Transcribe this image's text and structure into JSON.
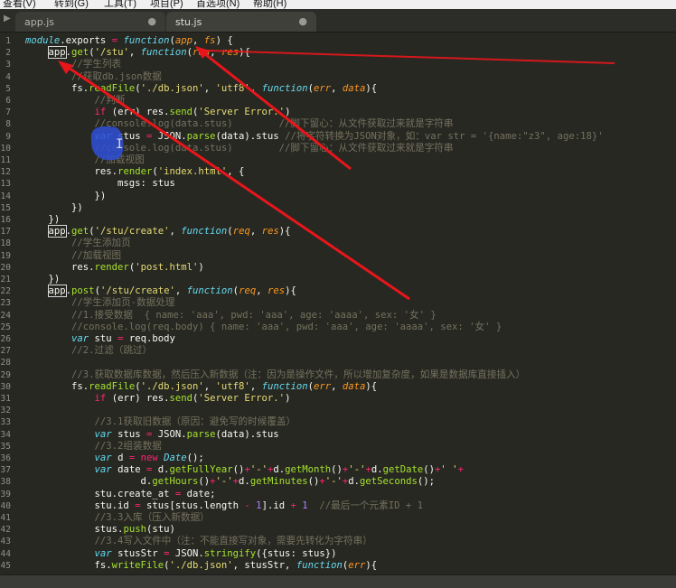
{
  "menu": [
    "查看(V)",
    "转到(G)",
    "工具(T)",
    "项目(P)",
    "首选项(N)",
    "帮助(H)"
  ],
  "tabs": [
    {
      "label": "app.js",
      "active": false,
      "status": "●"
    },
    {
      "label": "stu.js",
      "active": true,
      "status": "●"
    }
  ],
  "icons": {
    "sidebar_toggle": "triangle-right",
    "tab_modified": "dot"
  },
  "colors": {
    "background": "#272822",
    "keyword": "#66d9ef",
    "string": "#e6db74",
    "function_name": "#a6e22e",
    "parameter": "#fd971f",
    "operator": "#f92672",
    "comment": "#75715e",
    "plain": "#f8f8f2",
    "annotation_arrow": "#e8161b",
    "annotation_highlight": "#2f4fd6"
  },
  "code_lines": [
    {
      "n": "1",
      "tokens": [
        [
          "module",
          "i"
        ],
        [
          ".exports ",
          ""
        ],
        [
          "=",
          "o"
        ],
        [
          " ",
          ""
        ],
        [
          "function",
          "k"
        ],
        [
          "(",
          ""
        ],
        [
          "app",
          "p"
        ],
        [
          ", ",
          ""
        ],
        [
          "fs",
          "p"
        ],
        [
          ") {",
          ""
        ]
      ]
    },
    {
      "n": "2",
      "tokens": [
        [
          "    ",
          ""
        ],
        [
          "app",
          "b"
        ],
        [
          ".",
          ""
        ],
        [
          "get",
          "f"
        ],
        [
          "(",
          ""
        ],
        [
          "'/stu'",
          "s"
        ],
        [
          ", ",
          ""
        ],
        [
          "function",
          "k"
        ],
        [
          "(",
          ""
        ],
        [
          "req",
          "p"
        ],
        [
          ", ",
          ""
        ],
        [
          "res",
          "p"
        ],
        [
          "){",
          ""
        ]
      ]
    },
    {
      "n": "3",
      "tokens": [
        [
          "        //学生列表",
          "c"
        ]
      ]
    },
    {
      "n": "4",
      "tokens": [
        [
          "        //获取db.json数据",
          "c"
        ]
      ]
    },
    {
      "n": "5",
      "tokens": [
        [
          "        fs.",
          ""
        ],
        [
          "readFile",
          "f"
        ],
        [
          "(",
          ""
        ],
        [
          "'./db.json'",
          "s"
        ],
        [
          ", ",
          ""
        ],
        [
          "'utf8'",
          "s"
        ],
        [
          ", ",
          ""
        ],
        [
          "function",
          "k"
        ],
        [
          "(",
          ""
        ],
        [
          "err",
          "p"
        ],
        [
          ", ",
          ""
        ],
        [
          "data",
          "p"
        ],
        [
          "){",
          ""
        ]
      ]
    },
    {
      "n": "6",
      "tokens": [
        [
          "            //判断",
          "c"
        ]
      ]
    },
    {
      "n": "7",
      "tokens": [
        [
          "            ",
          ""
        ],
        [
          "if",
          "o"
        ],
        [
          " (err) res.",
          ""
        ],
        [
          "send",
          "f"
        ],
        [
          "(",
          ""
        ],
        [
          "'Server Error.'",
          "s"
        ],
        [
          ")",
          ""
        ]
      ]
    },
    {
      "n": "8",
      "tokens": [
        [
          "            //console.log(data.stus)        //脚下留心：从文件获取过来就是字符串",
          "c"
        ]
      ]
    },
    {
      "n": "9",
      "tokens": [
        [
          "            ",
          ""
        ],
        [
          "var",
          "k"
        ],
        [
          " stus ",
          ""
        ],
        [
          "=",
          "o"
        ],
        [
          " JSON.",
          ""
        ],
        [
          "parse",
          "f"
        ],
        [
          "(data).stus ",
          ""
        ],
        [
          "//将字符转换为JSON对象，如：var str = '{name:\"z3\", age:18}'",
          "c"
        ]
      ]
    },
    {
      "n": "10",
      "tokens": [
        [
          "            //console.log(data.stus)        //脚下留心：从文件获取过来就是字符串",
          "c"
        ]
      ]
    },
    {
      "n": "11",
      "tokens": [
        [
          "            //加载视图",
          "c"
        ]
      ]
    },
    {
      "n": "12",
      "tokens": [
        [
          "            res.",
          ""
        ],
        [
          "render",
          "f"
        ],
        [
          "(",
          ""
        ],
        [
          "'index.html'",
          "s"
        ],
        [
          ", {",
          ""
        ]
      ]
    },
    {
      "n": "13",
      "tokens": [
        [
          "                msgs: stus",
          ""
        ]
      ]
    },
    {
      "n": "14",
      "tokens": [
        [
          "            })",
          ""
        ]
      ]
    },
    {
      "n": "15",
      "tokens": [
        [
          "        })",
          ""
        ]
      ]
    },
    {
      "n": "16",
      "tokens": [
        [
          "    })",
          ""
        ]
      ]
    },
    {
      "n": "17",
      "tokens": [
        [
          "    ",
          ""
        ],
        [
          "app",
          "b"
        ],
        [
          ".",
          ""
        ],
        [
          "get",
          "f"
        ],
        [
          "(",
          ""
        ],
        [
          "'/stu/create'",
          "s"
        ],
        [
          ", ",
          ""
        ],
        [
          "function",
          "k"
        ],
        [
          "(",
          ""
        ],
        [
          "req",
          "p"
        ],
        [
          ", ",
          ""
        ],
        [
          "res",
          "p"
        ],
        [
          "){",
          ""
        ]
      ]
    },
    {
      "n": "18",
      "tokens": [
        [
          "        //学生添加页",
          "c"
        ]
      ]
    },
    {
      "n": "19",
      "tokens": [
        [
          "        //加载视图",
          "c"
        ]
      ]
    },
    {
      "n": "20",
      "tokens": [
        [
          "        res.",
          ""
        ],
        [
          "render",
          "f"
        ],
        [
          "(",
          ""
        ],
        [
          "'post.html'",
          "s"
        ],
        [
          ")",
          ""
        ]
      ]
    },
    {
      "n": "21",
      "tokens": [
        [
          "    })",
          ""
        ]
      ]
    },
    {
      "n": "22",
      "tokens": [
        [
          "    ",
          ""
        ],
        [
          "app",
          "b"
        ],
        [
          ".",
          ""
        ],
        [
          "post",
          "f"
        ],
        [
          "(",
          ""
        ],
        [
          "'/stu/create'",
          "s"
        ],
        [
          ", ",
          ""
        ],
        [
          "function",
          "k"
        ],
        [
          "(",
          ""
        ],
        [
          "req",
          "p"
        ],
        [
          ", ",
          ""
        ],
        [
          "res",
          "p"
        ],
        [
          "){",
          ""
        ]
      ]
    },
    {
      "n": "23",
      "tokens": [
        [
          "        //学生添加页-数据处理",
          "c"
        ]
      ]
    },
    {
      "n": "24",
      "tokens": [
        [
          "        //1.接受数据  { name: 'aaa', pwd: 'aaa', age: 'aaaa', sex: '女' }",
          "c"
        ]
      ]
    },
    {
      "n": "25",
      "tokens": [
        [
          "        //console.log(req.body) { name: 'aaa', pwd: 'aaa', age: 'aaaa', sex: '女' }",
          "c"
        ]
      ]
    },
    {
      "n": "26",
      "tokens": [
        [
          "        ",
          ""
        ],
        [
          "var",
          "k"
        ],
        [
          " stu ",
          ""
        ],
        [
          "=",
          "o"
        ],
        [
          " req.body",
          ""
        ]
      ]
    },
    {
      "n": "27",
      "tokens": [
        [
          "        //2.过滤（跳过）",
          "c"
        ]
      ]
    },
    {
      "n": "28",
      "tokens": [
        [
          "",
          ""
        ]
      ]
    },
    {
      "n": "29",
      "tokens": [
        [
          "        //3.获取数据库数据，然后压入新数据（注：因为是操作文件，所以增加复杂度，如果是数据库直接插入）",
          "c"
        ]
      ]
    },
    {
      "n": "30",
      "tokens": [
        [
          "        fs.",
          ""
        ],
        [
          "readFile",
          "f"
        ],
        [
          "(",
          ""
        ],
        [
          "'./db.json'",
          "s"
        ],
        [
          ", ",
          ""
        ],
        [
          "'utf8'",
          "s"
        ],
        [
          ", ",
          ""
        ],
        [
          "function",
          "k"
        ],
        [
          "(",
          ""
        ],
        [
          "err",
          "p"
        ],
        [
          ", ",
          ""
        ],
        [
          "data",
          "p"
        ],
        [
          "){",
          ""
        ]
      ]
    },
    {
      "n": "31",
      "tokens": [
        [
          "            ",
          ""
        ],
        [
          "if",
          "o"
        ],
        [
          " (err) res.",
          ""
        ],
        [
          "send",
          "f"
        ],
        [
          "(",
          ""
        ],
        [
          "'Server Error.'",
          "s"
        ],
        [
          ")",
          ""
        ]
      ]
    },
    {
      "n": "32",
      "tokens": [
        [
          "",
          ""
        ]
      ]
    },
    {
      "n": "33",
      "tokens": [
        [
          "            //3.1获取旧数据（原因：避免写的时候覆盖）",
          "c"
        ]
      ]
    },
    {
      "n": "34",
      "tokens": [
        [
          "            ",
          ""
        ],
        [
          "var",
          "k"
        ],
        [
          " stus ",
          ""
        ],
        [
          "=",
          "o"
        ],
        [
          " JSON.",
          ""
        ],
        [
          "parse",
          "f"
        ],
        [
          "(data).stus",
          ""
        ]
      ]
    },
    {
      "n": "35",
      "tokens": [
        [
          "            //3.2组装数据",
          "c"
        ]
      ]
    },
    {
      "n": "36",
      "tokens": [
        [
          "            ",
          ""
        ],
        [
          "var",
          "k"
        ],
        [
          " d ",
          ""
        ],
        [
          "=",
          "o"
        ],
        [
          " ",
          ""
        ],
        [
          "new",
          "o"
        ],
        [
          " ",
          ""
        ],
        [
          "Date",
          "i"
        ],
        [
          "();",
          ""
        ]
      ]
    },
    {
      "n": "37",
      "tokens": [
        [
          "            ",
          ""
        ],
        [
          "var",
          "k"
        ],
        [
          " date ",
          ""
        ],
        [
          "=",
          "o"
        ],
        [
          " d.",
          ""
        ],
        [
          "getFullYear",
          "f"
        ],
        [
          "()",
          ""
        ],
        [
          "+",
          "o"
        ],
        [
          "'-'",
          "s"
        ],
        [
          "+",
          "o"
        ],
        [
          "d.",
          ""
        ],
        [
          "getMonth",
          "f"
        ],
        [
          "()",
          ""
        ],
        [
          "+",
          "o"
        ],
        [
          "'-'",
          "s"
        ],
        [
          "+",
          "o"
        ],
        [
          "d.",
          ""
        ],
        [
          "getDate",
          "f"
        ],
        [
          "()",
          ""
        ],
        [
          "+",
          "o"
        ],
        [
          "' '",
          "s"
        ],
        [
          "+",
          "o"
        ]
      ]
    },
    {
      "n": "38",
      "tokens": [
        [
          "                    d.",
          ""
        ],
        [
          "getHours",
          "f"
        ],
        [
          "()",
          ""
        ],
        [
          "+",
          "o"
        ],
        [
          "'-'",
          "s"
        ],
        [
          "+",
          "o"
        ],
        [
          "d.",
          ""
        ],
        [
          "getMinutes",
          "f"
        ],
        [
          "()",
          ""
        ],
        [
          "+",
          "o"
        ],
        [
          "'-'",
          "s"
        ],
        [
          "+",
          "o"
        ],
        [
          "d.",
          ""
        ],
        [
          "getSeconds",
          "f"
        ],
        [
          "();",
          ""
        ]
      ]
    },
    {
      "n": "39",
      "tokens": [
        [
          "            stu.create_at ",
          ""
        ],
        [
          "=",
          "o"
        ],
        [
          " date;",
          ""
        ]
      ]
    },
    {
      "n": "40",
      "tokens": [
        [
          "            stu.id ",
          ""
        ],
        [
          "=",
          "o"
        ],
        [
          " stus[stus.length ",
          ""
        ],
        [
          "-",
          "o"
        ],
        [
          " ",
          ""
        ],
        [
          "1",
          "n"
        ],
        [
          "].id ",
          ""
        ],
        [
          "+",
          "o"
        ],
        [
          " ",
          ""
        ],
        [
          "1",
          "n"
        ],
        [
          "  ",
          ""
        ],
        [
          "//最后一个元素ID + 1",
          "c"
        ]
      ]
    },
    {
      "n": "41",
      "tokens": [
        [
          "            //3.3入库（压入新数据）",
          "c"
        ]
      ]
    },
    {
      "n": "42",
      "tokens": [
        [
          "            stus.",
          ""
        ],
        [
          "push",
          "f"
        ],
        [
          "(stu)",
          ""
        ]
      ]
    },
    {
      "n": "43",
      "tokens": [
        [
          "            //3.4写入文件中（注：不能直接写对象，需要先转化为字符串）",
          "c"
        ]
      ]
    },
    {
      "n": "44",
      "tokens": [
        [
          "            ",
          ""
        ],
        [
          "var",
          "k"
        ],
        [
          " stusStr ",
          ""
        ],
        [
          "=",
          "o"
        ],
        [
          " JSON.",
          ""
        ],
        [
          "stringify",
          "f"
        ],
        [
          "({stus: stus})",
          ""
        ]
      ]
    },
    {
      "n": "45",
      "tokens": [
        [
          "            fs.",
          ""
        ],
        [
          "writeFile",
          "f"
        ],
        [
          "(",
          ""
        ],
        [
          "'./db.json'",
          "s"
        ],
        [
          ", stusStr, ",
          ""
        ],
        [
          "function",
          "k"
        ],
        [
          "(",
          ""
        ],
        [
          "err",
          "p"
        ],
        [
          "){",
          ""
        ]
      ]
    }
  ]
}
